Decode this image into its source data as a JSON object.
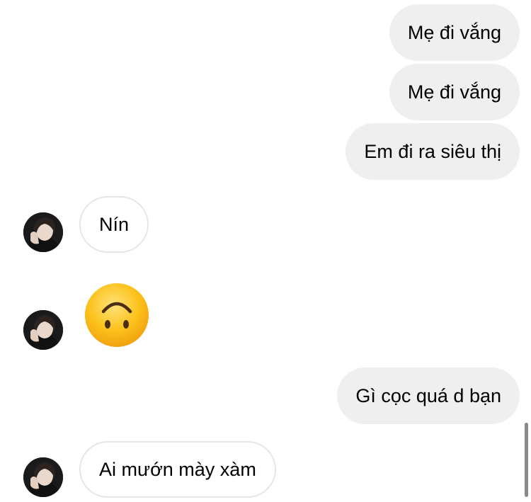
{
  "messages": {
    "m1": "Mẹ đi vắng",
    "m2": "Mẹ đi vắng",
    "m3": "Em đi ra siêu thị",
    "m4": "Nín",
    "m5_emoji": "upside-down-face",
    "m6": "Gì cọc quá d bạn",
    "m7": "Ai mướn mày xàm"
  },
  "colors": {
    "outgoing_bubble": "#efefef",
    "incoming_border": "#e6e6e6",
    "emoji_face": "#fcc21b"
  }
}
